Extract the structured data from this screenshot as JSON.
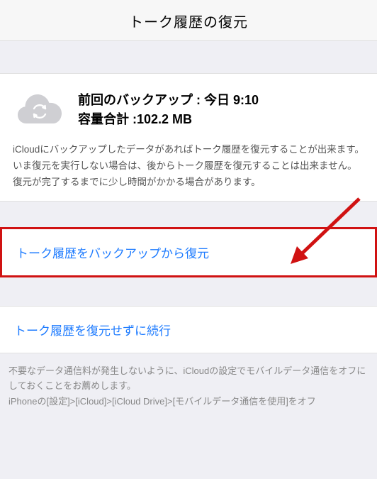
{
  "header": {
    "title": "トーク履歴の復元"
  },
  "backup": {
    "label_prefix": "前回のバックアップ : ",
    "last_backup": "今日 9:10",
    "size_label": "容量合計 :",
    "size_value": "102.2 MB"
  },
  "description": {
    "line1": "iCloudにバックアップしたデータがあればトーク履歴を復元することが出来ます。",
    "line2": "いま復元を実行しない場合は、後からトーク履歴を復元することは出来ません。",
    "line3": "復元が完了するまでに少し時間がかかる場合があります。"
  },
  "actions": {
    "restore": "トーク履歴をバックアップから復元",
    "skip": "トーク履歴を復元せずに続行"
  },
  "footer": {
    "line1": "不要なデータ通信料が発生しないように、iCloudの設定でモバイルデータ通信をオフにしておくことをお薦めします。",
    "line2": "iPhoneの[設定]>[iCloud]>[iCloud Drive]>[モバイルデータ通信を使用]をオフ"
  },
  "annotation": {
    "arrow_color": "#d01212"
  }
}
